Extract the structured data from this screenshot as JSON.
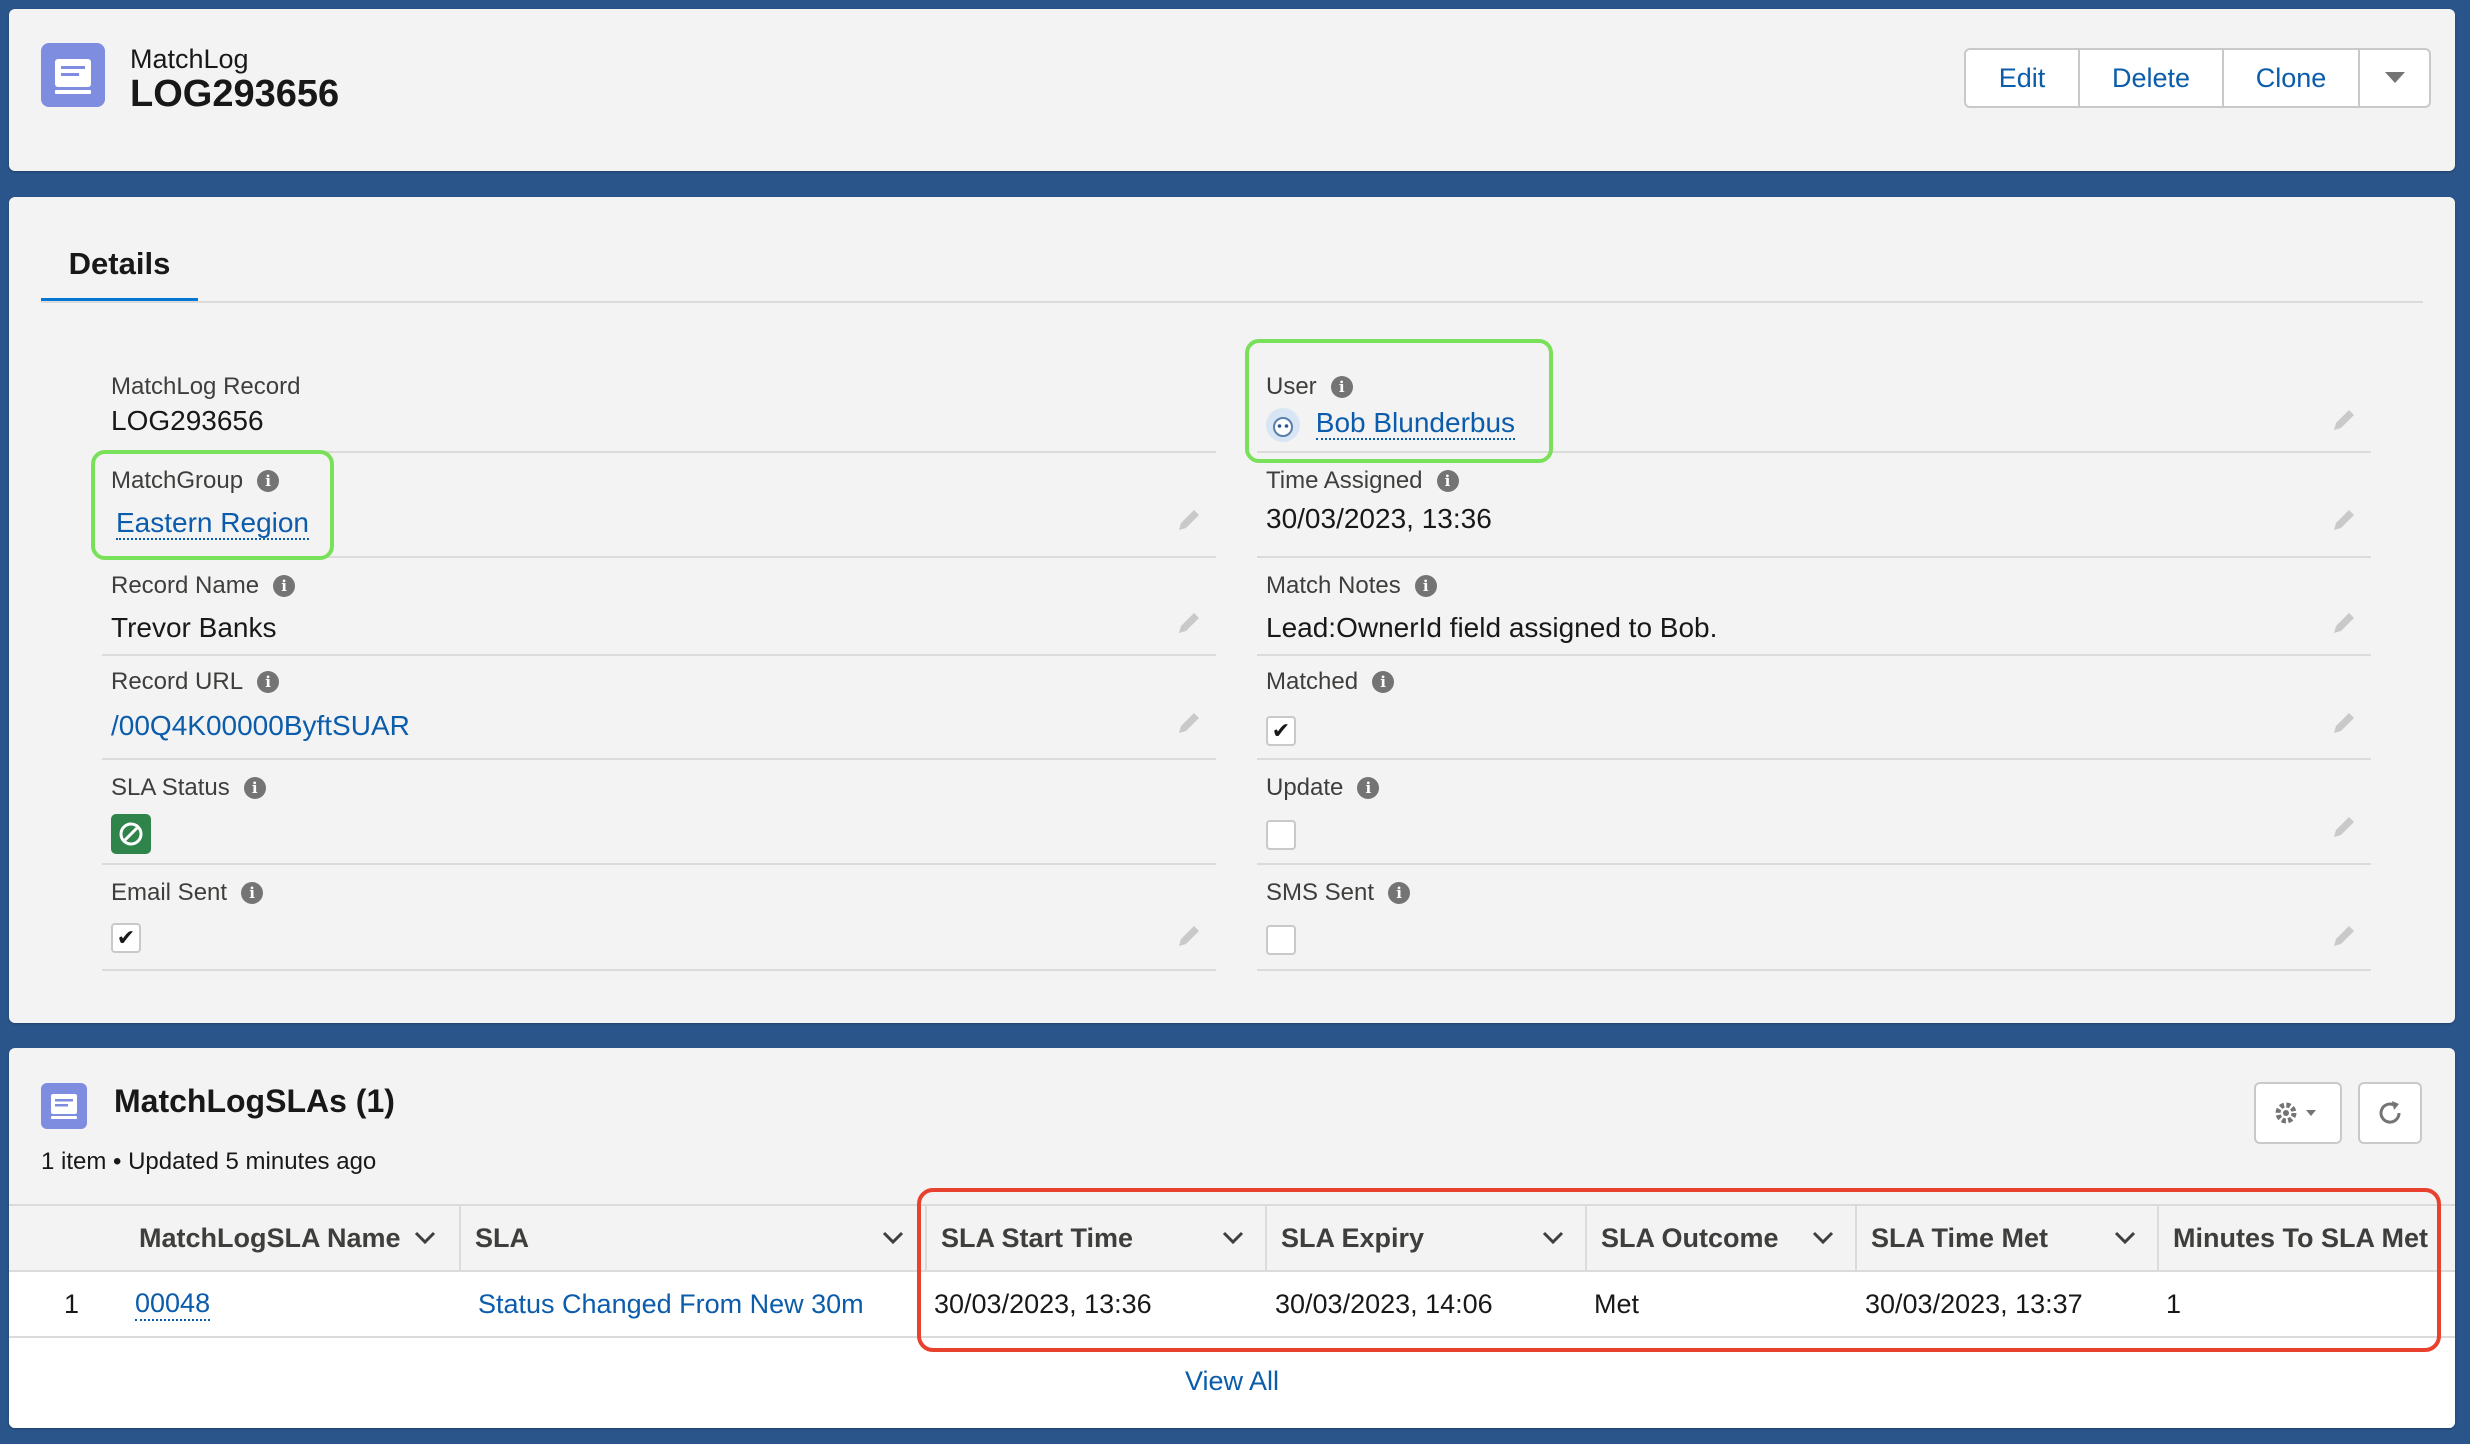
{
  "header": {
    "object_type": "MatchLog",
    "record_title": "LOG293656",
    "actions": [
      "Edit",
      "Delete",
      "Clone"
    ]
  },
  "details": {
    "tab_label": "Details",
    "left": {
      "record": {
        "label": "MatchLog Record",
        "value": "LOG293656"
      },
      "match_group": {
        "label": "MatchGroup",
        "value": "Eastern Region"
      },
      "record_name": {
        "label": "Record Name",
        "value": "Trevor Banks"
      },
      "record_url": {
        "label": "Record URL",
        "value": "/00Q4K00000ByftSUAR"
      },
      "sla_status": {
        "label": "SLA Status"
      },
      "email_sent": {
        "label": "Email Sent",
        "checked": true
      }
    },
    "right": {
      "user": {
        "label": "User",
        "value": "Bob Blunderbus"
      },
      "time_assigned": {
        "label": "Time Assigned",
        "value": "30/03/2023, 13:36"
      },
      "match_notes": {
        "label": "Match Notes",
        "value": "Lead:OwnerId field assigned to Bob."
      },
      "matched": {
        "label": "Matched",
        "checked": true
      },
      "update": {
        "label": "Update",
        "checked": false
      },
      "sms_sent": {
        "label": "SMS Sent",
        "checked": false
      }
    }
  },
  "related": {
    "title": "MatchLogSLAs (1)",
    "subtitle": "1 item • Updated 5 minutes ago",
    "columns": [
      "MatchLogSLA Name",
      "SLA",
      "SLA Start Time",
      "SLA Expiry",
      "SLA Outcome",
      "SLA Time Met",
      "Minutes To SLA Met"
    ],
    "rows": [
      {
        "num": "1",
        "name": "00048",
        "sla": "Status Changed From New 30m",
        "start": "30/03/2023, 13:36",
        "expiry": "30/03/2023, 14:06",
        "outcome": "Met",
        "time_met": "30/03/2023, 13:37",
        "minutes": "1"
      }
    ],
    "view_all": "View All"
  },
  "colors": {
    "brand_link": "#0b5cab",
    "page_bg": "#2a558a",
    "highlight_green": "#79e05a",
    "highlight_red": "#e8412e",
    "object_icon": "#7f8de1"
  }
}
